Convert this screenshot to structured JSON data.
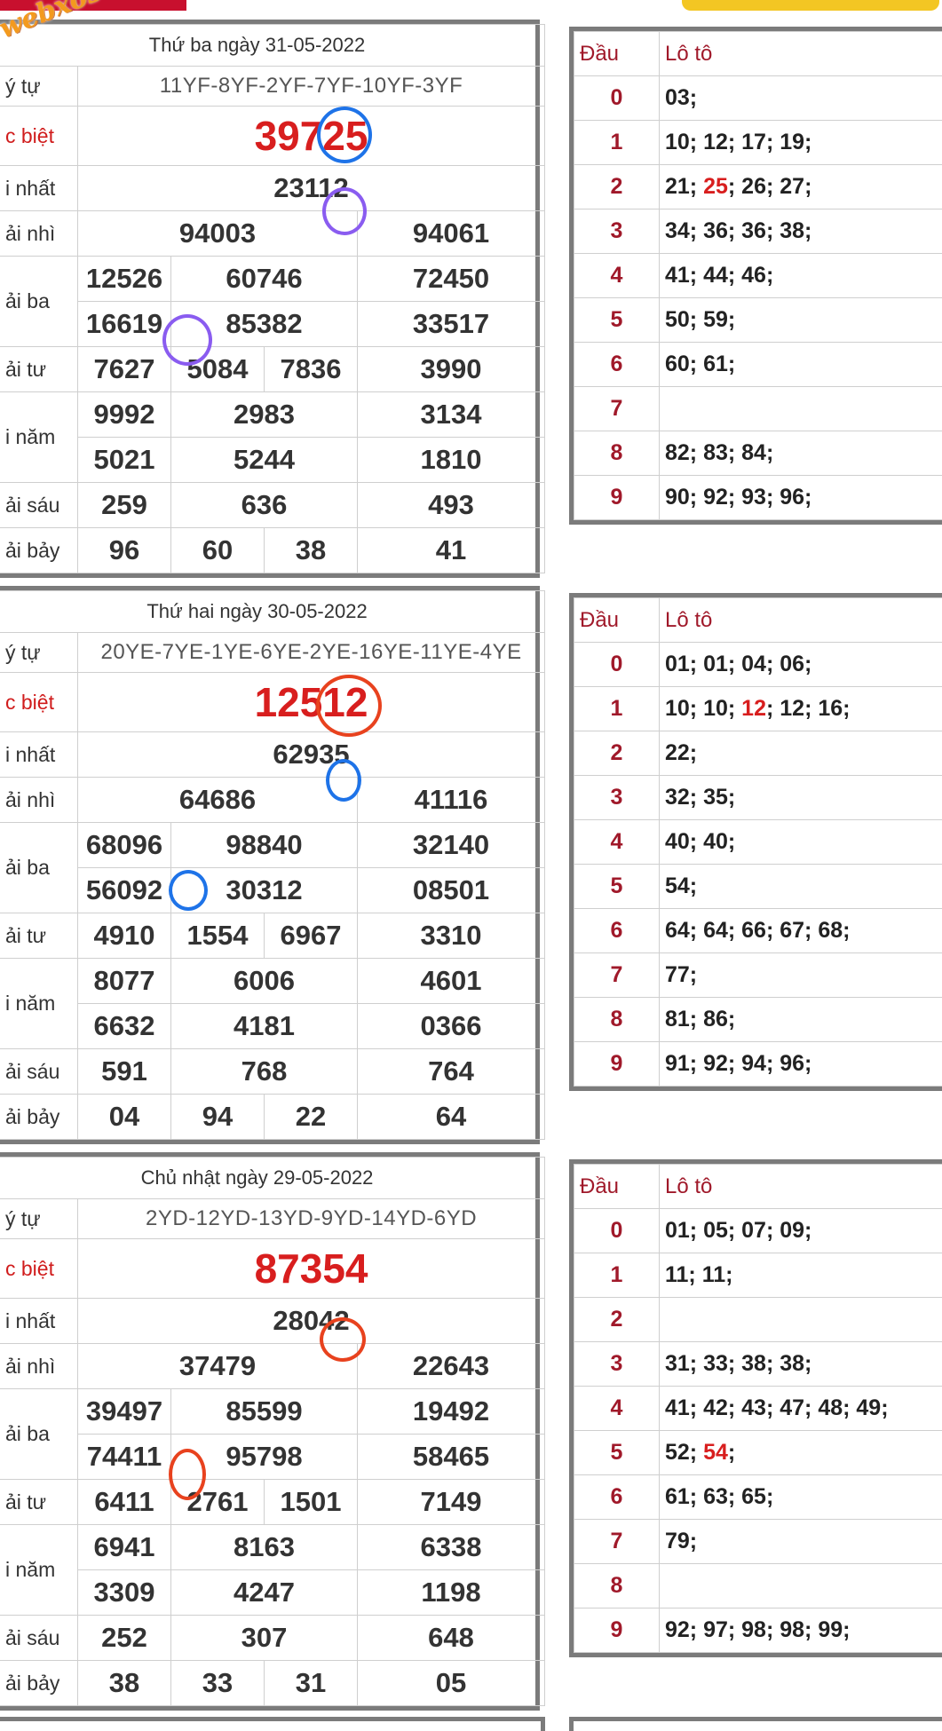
{
  "logo": "webxoso.net",
  "labels": {
    "code": "ý tự",
    "special": "c biệt",
    "first": "i nhất",
    "second": "ải nhì",
    "third": "ải ba",
    "fourth": "ải tư",
    "fifth": "i năm",
    "sixth": "ải sáu",
    "seventh": "ải bảy"
  },
  "loto_headers": {
    "dau": "Đầu",
    "loto": "Lô tô"
  },
  "results": [
    {
      "date": "Thứ ba ngày 31-05-2022",
      "code": "11YF-8YF-2YF-7YF-10YF-3YF",
      "special": "39725",
      "first": "23112",
      "second": [
        "94003",
        "94061"
      ],
      "third": [
        "12526",
        "60746",
        "72450",
        "16619",
        "85382",
        "33517"
      ],
      "fourth": [
        "7627",
        "5084",
        "7836",
        "3990"
      ],
      "fifth": [
        "9992",
        "2983",
        "3134",
        "5021",
        "5244",
        "1810"
      ],
      "sixth": [
        "259",
        "636",
        "493"
      ],
      "seventh": [
        "96",
        "60",
        "38",
        "41"
      ],
      "loto": [
        {
          "d": "0",
          "v": "03;"
        },
        {
          "d": "1",
          "v": "10; 12; 17; 19;"
        },
        {
          "d": "2",
          "pre": "21; ",
          "hl": "25",
          "post": "; 26; 27;"
        },
        {
          "d": "3",
          "v": "34; 36; 36; 38;"
        },
        {
          "d": "4",
          "v": "41; 44; 46;"
        },
        {
          "d": "5",
          "v": "50; 59;"
        },
        {
          "d": "6",
          "v": "60; 61;"
        },
        {
          "d": "7",
          "v": ""
        },
        {
          "d": "8",
          "v": "82; 83; 84;"
        },
        {
          "d": "9",
          "v": "90; 92; 93; 96;"
        }
      ]
    },
    {
      "date": "Thứ hai ngày 30-05-2022",
      "code": "20YE-7YE-1YE-6YE-2YE-16YE-11YE-4YE",
      "special": "12512",
      "first": "62935",
      "second": [
        "64686",
        "41116"
      ],
      "third": [
        "68096",
        "98840",
        "32140",
        "56092",
        "30312",
        "08501"
      ],
      "fourth": [
        "4910",
        "1554",
        "6967",
        "3310"
      ],
      "fifth": [
        "8077",
        "6006",
        "4601",
        "6632",
        "4181",
        "0366"
      ],
      "sixth": [
        "591",
        "768",
        "764"
      ],
      "seventh": [
        "04",
        "94",
        "22",
        "64"
      ],
      "loto": [
        {
          "d": "0",
          "v": "01; 01; 04; 06;"
        },
        {
          "d": "1",
          "pre": "10; 10; ",
          "hl": "12",
          "post": "; 12; 16;"
        },
        {
          "d": "2",
          "v": "22;"
        },
        {
          "d": "3",
          "v": "32; 35;"
        },
        {
          "d": "4",
          "v": "40; 40;"
        },
        {
          "d": "5",
          "v": "54;"
        },
        {
          "d": "6",
          "v": "64; 64; 66; 67; 68;"
        },
        {
          "d": "7",
          "v": "77;"
        },
        {
          "d": "8",
          "v": "81; 86;"
        },
        {
          "d": "9",
          "v": "91; 92; 94; 96;"
        }
      ]
    },
    {
      "date": "Chủ nhật ngày 29-05-2022",
      "code": "2YD-12YD-13YD-9YD-14YD-6YD",
      "special": "87354",
      "first": "28042",
      "second": [
        "37479",
        "22643"
      ],
      "third": [
        "39497",
        "85599",
        "19492",
        "74411",
        "95798",
        "58465"
      ],
      "fourth": [
        "6411",
        "2761",
        "1501",
        "7149"
      ],
      "fifth": [
        "6941",
        "8163",
        "6338",
        "3309",
        "4247",
        "1198"
      ],
      "sixth": [
        "252",
        "307",
        "648"
      ],
      "seventh": [
        "38",
        "33",
        "31",
        "05"
      ],
      "loto": [
        {
          "d": "0",
          "v": "01; 05; 07; 09;"
        },
        {
          "d": "1",
          "v": "11; 11;"
        },
        {
          "d": "2",
          "v": ""
        },
        {
          "d": "3",
          "v": "31; 33; 38; 38;"
        },
        {
          "d": "4",
          "v": "41; 42; 43; 47; 48; 49;"
        },
        {
          "d": "5",
          "pre": "52; ",
          "hl": "54",
          "post": ";"
        },
        {
          "d": "6",
          "v": "61; 63; 65;"
        },
        {
          "d": "7",
          "v": "79;"
        },
        {
          "d": "8",
          "v": ""
        },
        {
          "d": "9",
          "v": "92; 97; 98; 98; 99;"
        }
      ]
    }
  ],
  "colors": {
    "accent_red": "#d81e1e",
    "dau_red": "#a0192a",
    "border_gray": "#7b7b7b",
    "mark_blue": "#1e73e8",
    "mark_purple": "#8a5cf0",
    "mark_red": "#e8421e"
  }
}
